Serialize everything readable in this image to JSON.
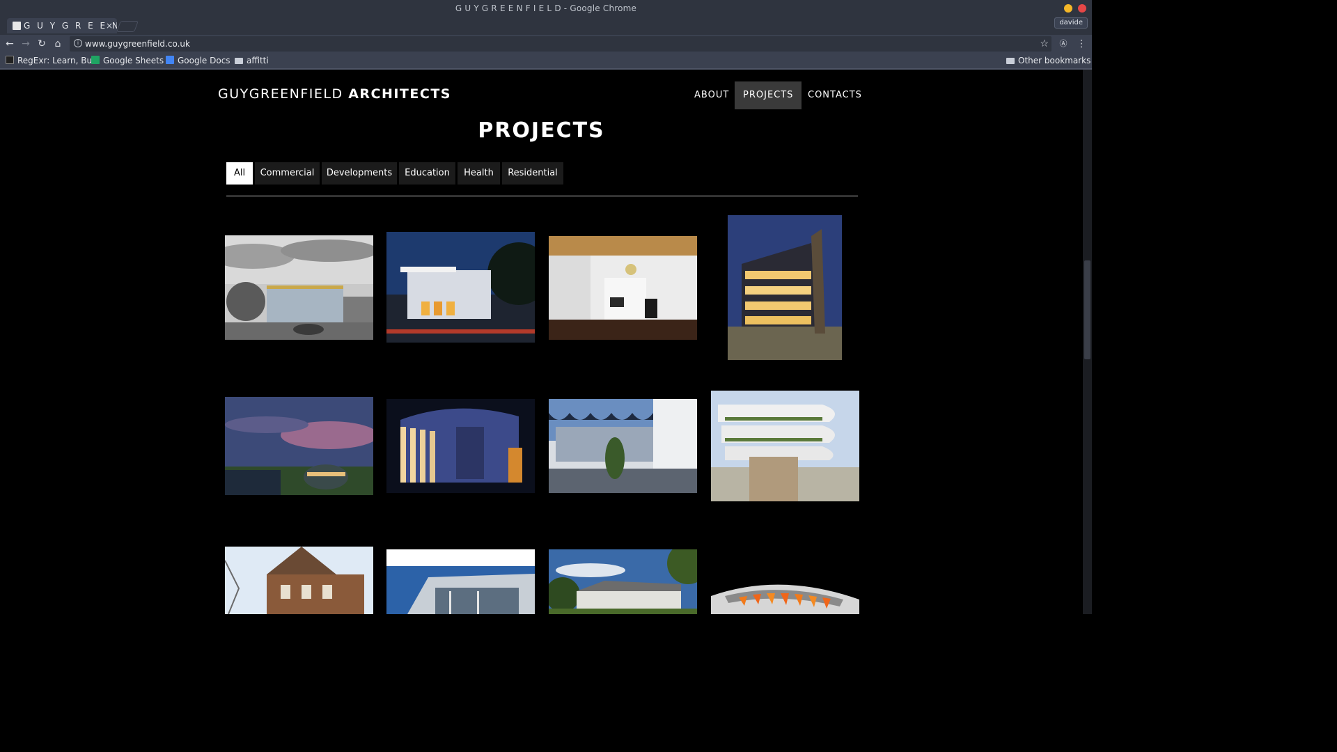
{
  "window": {
    "title": "G U Y G R E E N F I E L D - Google Chrome",
    "profile": "davide"
  },
  "tab": {
    "label": "G U Y G R E E N F I E L D",
    "close": "×"
  },
  "address": {
    "url": "www.guygreenfield.co.uk"
  },
  "bookmarks": {
    "items": [
      {
        "label": "RegExr: Learn, Bu"
      },
      {
        "label": "Google Sheets"
      },
      {
        "label": "Google Docs"
      },
      {
        "label": "affitti"
      }
    ],
    "other": "Other bookmarks"
  },
  "site": {
    "logo_light": "GUYGREENFIELD",
    "logo_bold": "ARCHITECTS",
    "nav": [
      "ABOUT",
      "PROJECTS",
      "CONTACTS"
    ],
    "active_nav": "PROJECTS",
    "title": "PROJECTS",
    "filters": [
      "All",
      "Commercial",
      "Developments",
      "Education",
      "Health",
      "Residential"
    ],
    "active_filter": "All"
  },
  "projects": [
    {
      "image": "grey-street-facade-render"
    },
    {
      "image": "white-house-dusk"
    },
    {
      "image": "white-kitchen-interior"
    },
    {
      "image": "apartment-tower-night"
    },
    {
      "image": "coastal-building-sunset"
    },
    {
      "image": "curved-facade-night"
    },
    {
      "image": "wave-roof-building"
    },
    {
      "image": "terraced-apartments-render"
    },
    {
      "image": "victorian-brick-house"
    },
    {
      "image": "glass-modern-house"
    },
    {
      "image": "houses-among-trees"
    },
    {
      "image": "orange-roof-model"
    }
  ]
}
